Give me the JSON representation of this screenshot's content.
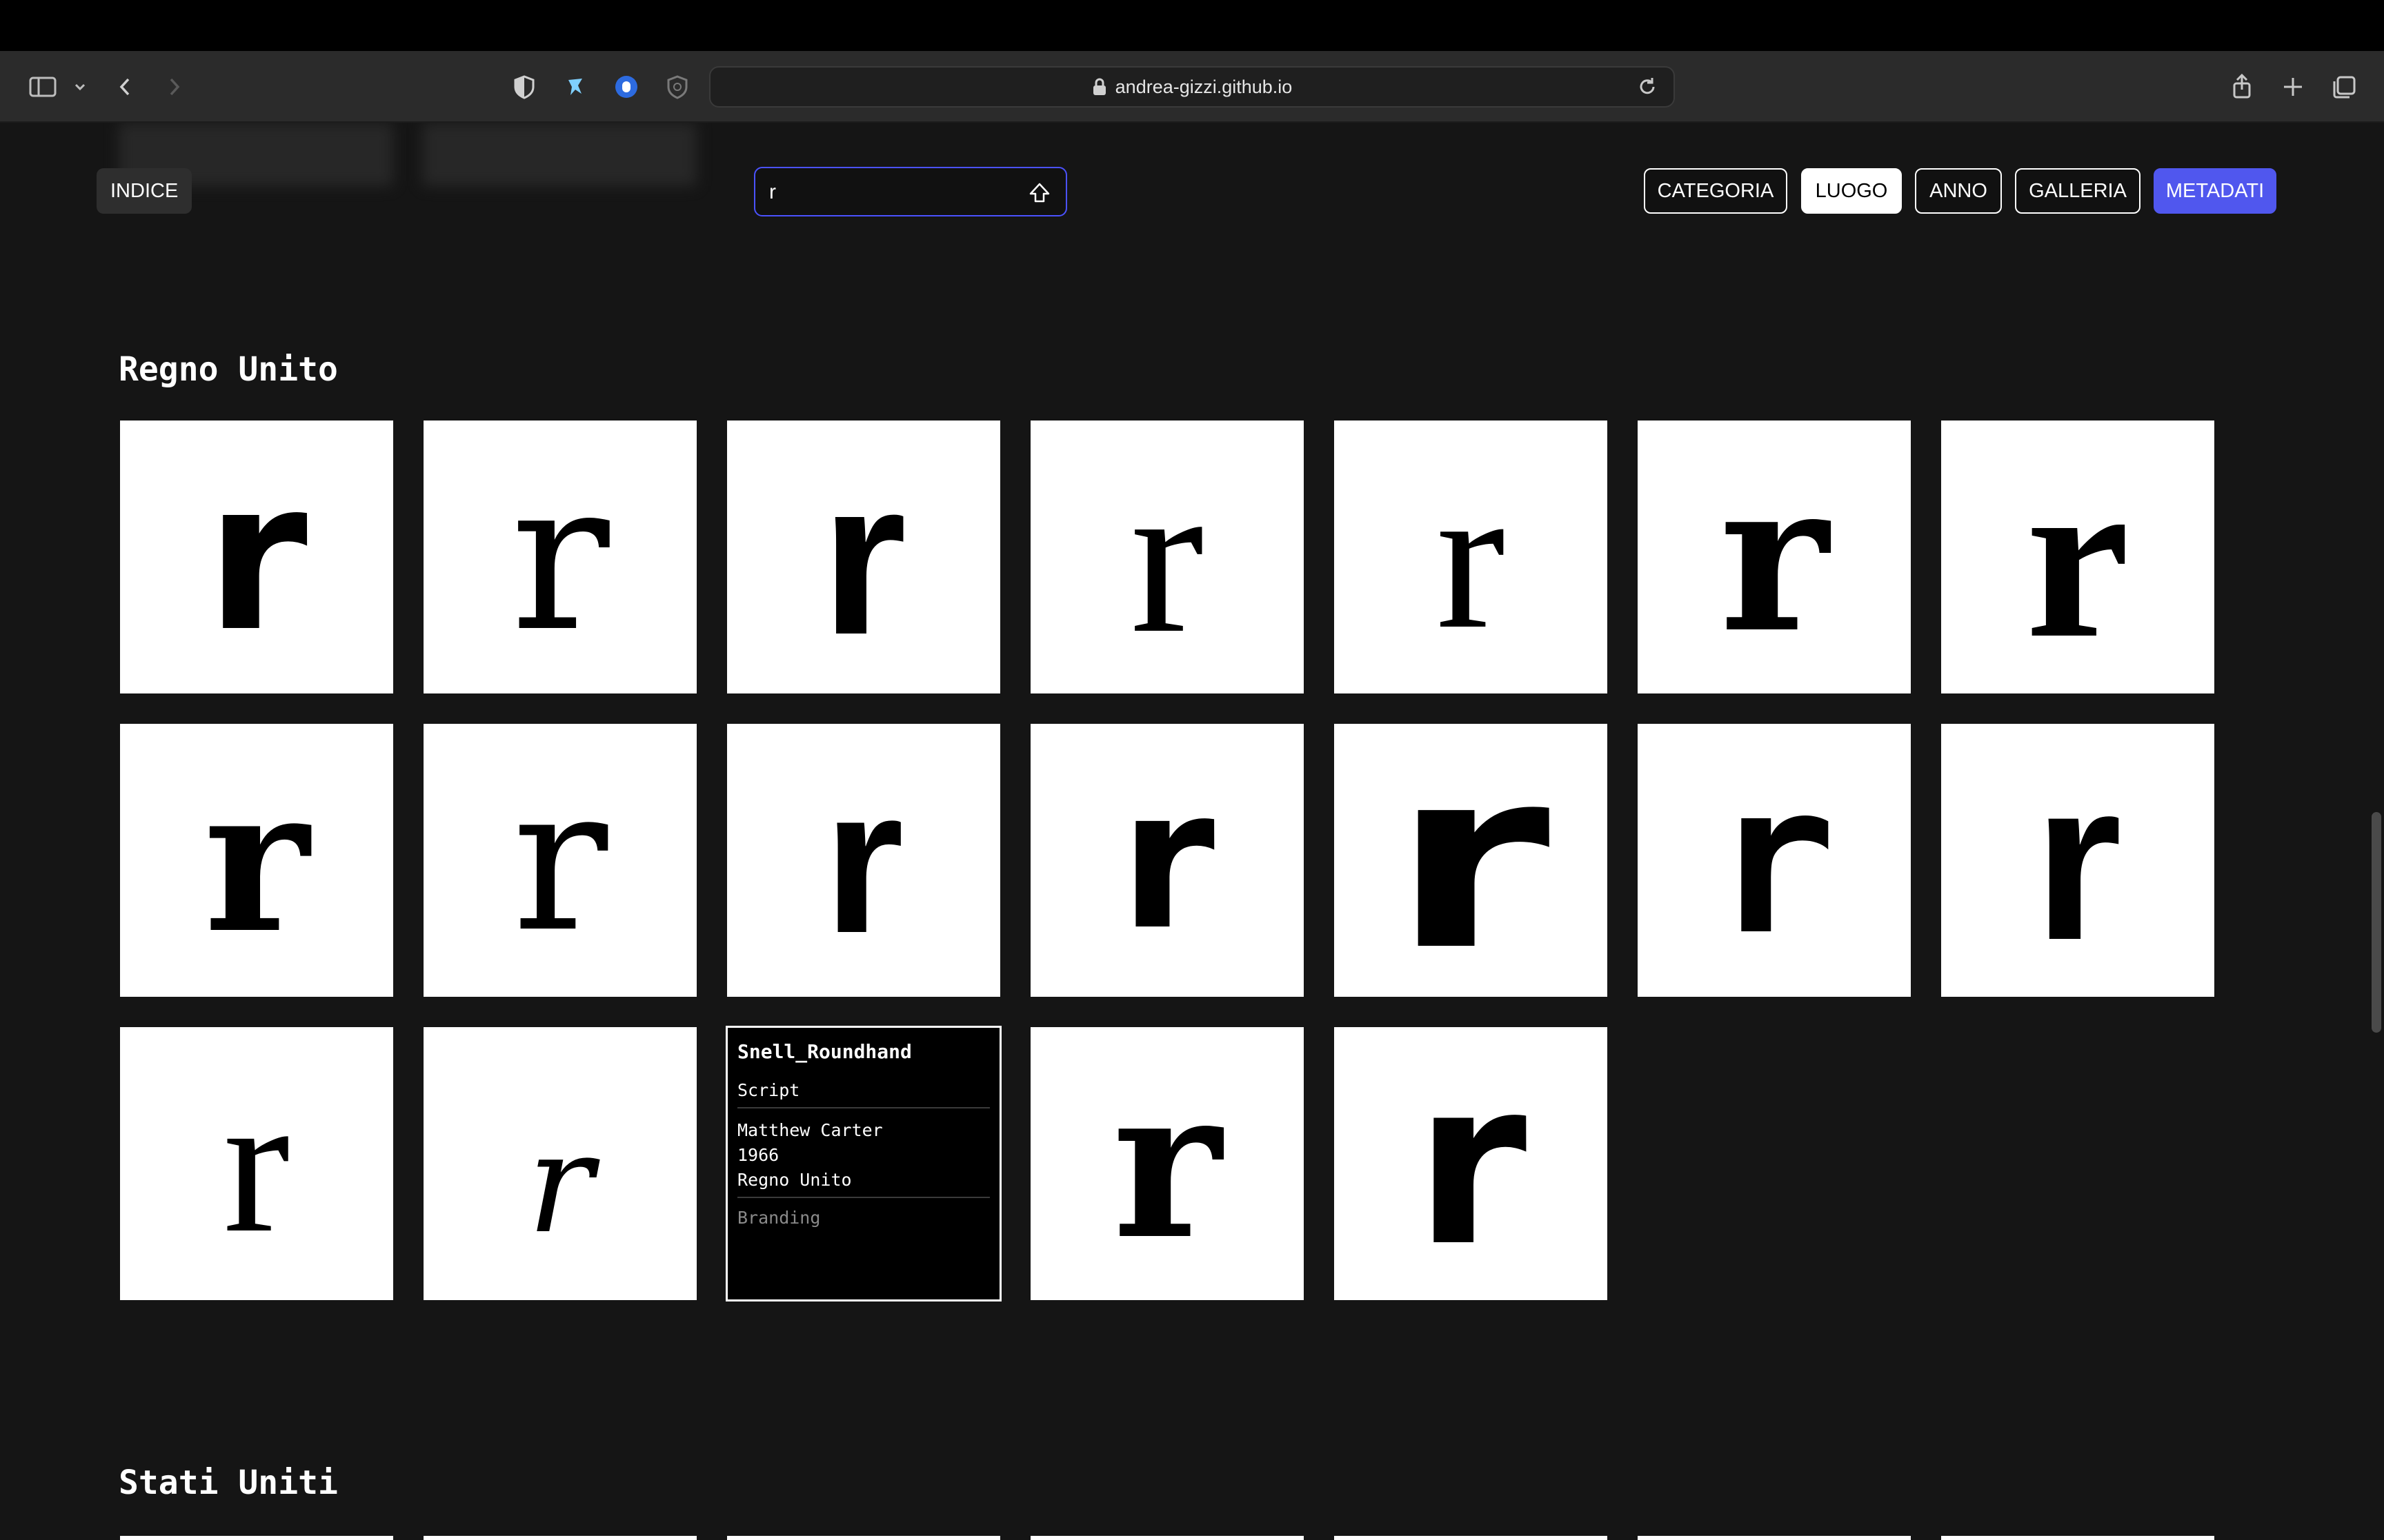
{
  "browser": {
    "url": "andrea-gizzi.github.io",
    "icons": [
      "sidebar-icon",
      "chevron-down-icon",
      "back-icon",
      "forward-icon",
      "shield-icon",
      "extension-icon",
      "privacy-icon",
      "tracker-icon",
      "reload-icon",
      "share-icon",
      "plus-icon",
      "tabs-icon"
    ]
  },
  "nav": {
    "index_label": "INDICE",
    "search_value": "r",
    "filters": [
      "CATEGORIA",
      "LUOGO",
      "ANNO",
      "GALLERIA",
      "METADATI"
    ],
    "active_filter": "LUOGO",
    "highlight_filter": "METADATI",
    "accent": "#5057ee"
  },
  "sections": [
    {
      "title": "Regno Unito",
      "count": 19
    },
    {
      "title": "Stati Uniti"
    }
  ],
  "hover_card": {
    "name": "Snell_Roundhand",
    "category": "Script",
    "designer": "Matthew Carter",
    "year": "1966",
    "place": "Regno Unito",
    "use": "Branding"
  },
  "glyph": "r"
}
